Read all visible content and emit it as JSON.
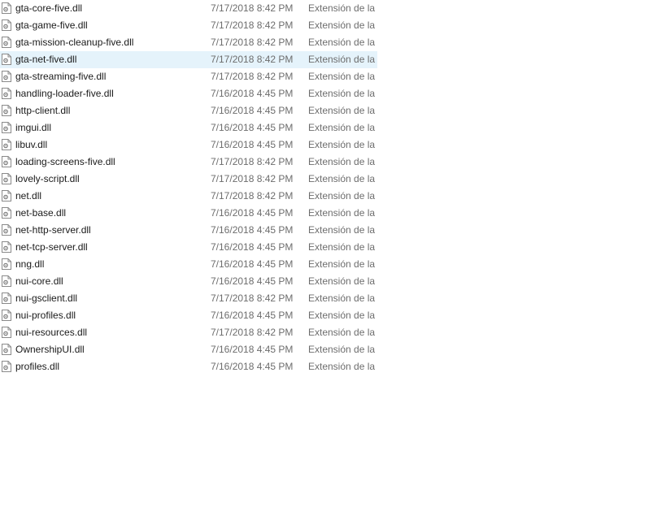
{
  "file_list": {
    "selected_index": 3,
    "icon": "dll-file-icon",
    "rows": [
      {
        "name": "gta-core-five.dll",
        "date": "7/17/2018 8:42 PM",
        "type": "Extensión de la aplicación"
      },
      {
        "name": "gta-game-five.dll",
        "date": "7/17/2018 8:42 PM",
        "type": "Extensión de la aplicación"
      },
      {
        "name": "gta-mission-cleanup-five.dll",
        "date": "7/17/2018 8:42 PM",
        "type": "Extensión de la aplicación"
      },
      {
        "name": "gta-net-five.dll",
        "date": "7/17/2018 8:42 PM",
        "type": "Extensión de la aplicación"
      },
      {
        "name": "gta-streaming-five.dll",
        "date": "7/17/2018 8:42 PM",
        "type": "Extensión de la aplicación"
      },
      {
        "name": "handling-loader-five.dll",
        "date": "7/16/2018 4:45 PM",
        "type": "Extensión de la aplicación"
      },
      {
        "name": "http-client.dll",
        "date": "7/16/2018 4:45 PM",
        "type": "Extensión de la aplicación"
      },
      {
        "name": "imgui.dll",
        "date": "7/16/2018 4:45 PM",
        "type": "Extensión de la aplicación"
      },
      {
        "name": "libuv.dll",
        "date": "7/16/2018 4:45 PM",
        "type": "Extensión de la aplicación"
      },
      {
        "name": "loading-screens-five.dll",
        "date": "7/17/2018 8:42 PM",
        "type": "Extensión de la aplicación"
      },
      {
        "name": "lovely-script.dll",
        "date": "7/17/2018 8:42 PM",
        "type": "Extensión de la aplicación"
      },
      {
        "name": "net.dll",
        "date": "7/17/2018 8:42 PM",
        "type": "Extensión de la aplicación"
      },
      {
        "name": "net-base.dll",
        "date": "7/16/2018 4:45 PM",
        "type": "Extensión de la aplicación"
      },
      {
        "name": "net-http-server.dll",
        "date": "7/16/2018 4:45 PM",
        "type": "Extensión de la aplicación"
      },
      {
        "name": "net-tcp-server.dll",
        "date": "7/16/2018 4:45 PM",
        "type": "Extensión de la aplicación"
      },
      {
        "name": "nng.dll",
        "date": "7/16/2018 4:45 PM",
        "type": "Extensión de la aplicación"
      },
      {
        "name": "nui-core.dll",
        "date": "7/16/2018 4:45 PM",
        "type": "Extensión de la aplicación"
      },
      {
        "name": "nui-gsclient.dll",
        "date": "7/17/2018 8:42 PM",
        "type": "Extensión de la aplicación"
      },
      {
        "name": "nui-profiles.dll",
        "date": "7/16/2018 4:45 PM",
        "type": "Extensión de la aplicación"
      },
      {
        "name": "nui-resources.dll",
        "date": "7/17/2018 8:42 PM",
        "type": "Extensión de la aplicación"
      },
      {
        "name": "OwnershipUI.dll",
        "date": "7/16/2018 4:45 PM",
        "type": "Extensión de la aplicación"
      },
      {
        "name": "profiles.dll",
        "date": "7/16/2018 4:45 PM",
        "type": "Extensión de la aplicación"
      }
    ]
  },
  "colors": {
    "selected_row": "#e5f3fb",
    "name_text": "#1a1a1a",
    "meta_text": "#6d6d6d"
  }
}
